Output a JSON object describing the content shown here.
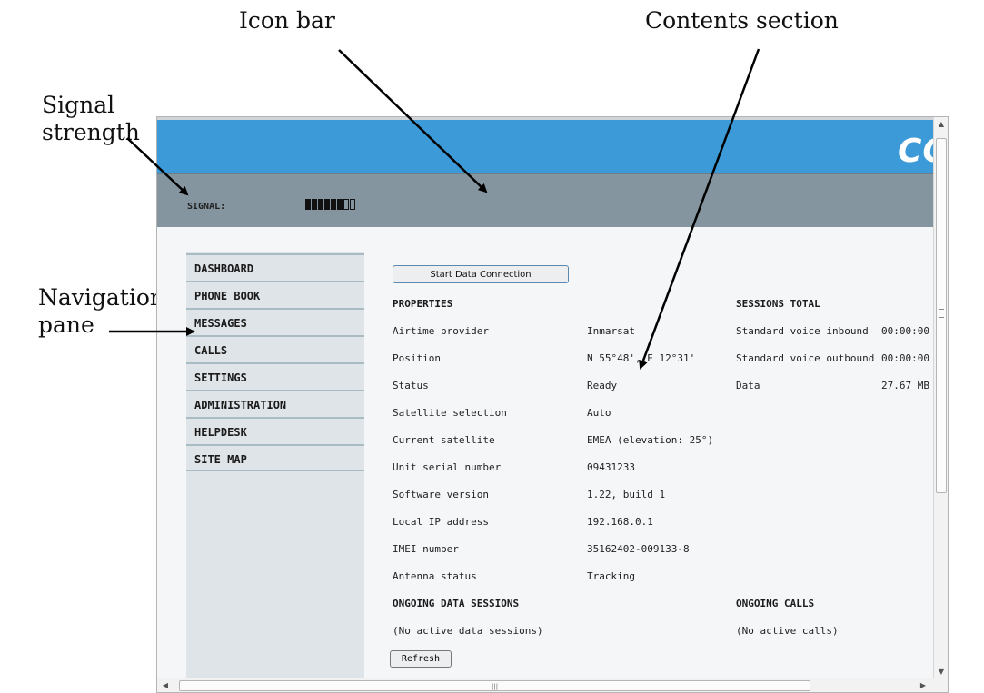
{
  "callouts": {
    "icon_bar": "Icon bar",
    "contents_section": "Contents section",
    "signal_line1": "Signal",
    "signal_line2": "strength",
    "nav_line1": "Navigation",
    "nav_line2": "pane"
  },
  "header": {
    "logo_text": "CO"
  },
  "icon_bar": {
    "signal_label": "SIGNAL:",
    "signal_level": {
      "filled": 6,
      "total": 8
    }
  },
  "nav": {
    "items": [
      "DASHBOARD",
      "PHONE BOOK",
      "MESSAGES",
      "CALLS",
      "SETTINGS",
      "ADMINISTRATION",
      "HELPDESK",
      "SITE MAP"
    ]
  },
  "content": {
    "start_button": "Start Data Connection",
    "properties_heading": "PROPERTIES",
    "properties": [
      {
        "label": "Airtime provider",
        "value": "Inmarsat"
      },
      {
        "label": "Position",
        "value": "N 55°48', E 12°31'"
      },
      {
        "label": "Status",
        "value": "Ready"
      },
      {
        "label": "Satellite selection",
        "value": "Auto"
      },
      {
        "label": "Current satellite",
        "value": "EMEA (elevation: 25°)"
      },
      {
        "label": "Unit serial number",
        "value": "09431233"
      },
      {
        "label": "Software version",
        "value": "1.22, build 1"
      },
      {
        "label": "Local IP address",
        "value": "192.168.0.1"
      },
      {
        "label": "IMEI number",
        "value": "35162402-009133-8"
      },
      {
        "label": "Antenna status",
        "value": "Tracking"
      }
    ],
    "sessions_heading": "SESSIONS TOTAL",
    "sessions": [
      {
        "label": "Standard voice inbound",
        "value": "00:00:00"
      },
      {
        "label": "Standard voice outbound",
        "value": "00:00:00"
      },
      {
        "label": "Data",
        "value": "27.67 MB"
      }
    ],
    "ongoing_data_heading": "ONGOING DATA SESSIONS",
    "ongoing_data_text": "(No active data sessions)",
    "ongoing_calls_heading": "ONGOING CALLS",
    "ongoing_calls_text": "(No active calls)",
    "refresh_button": "Refresh"
  }
}
